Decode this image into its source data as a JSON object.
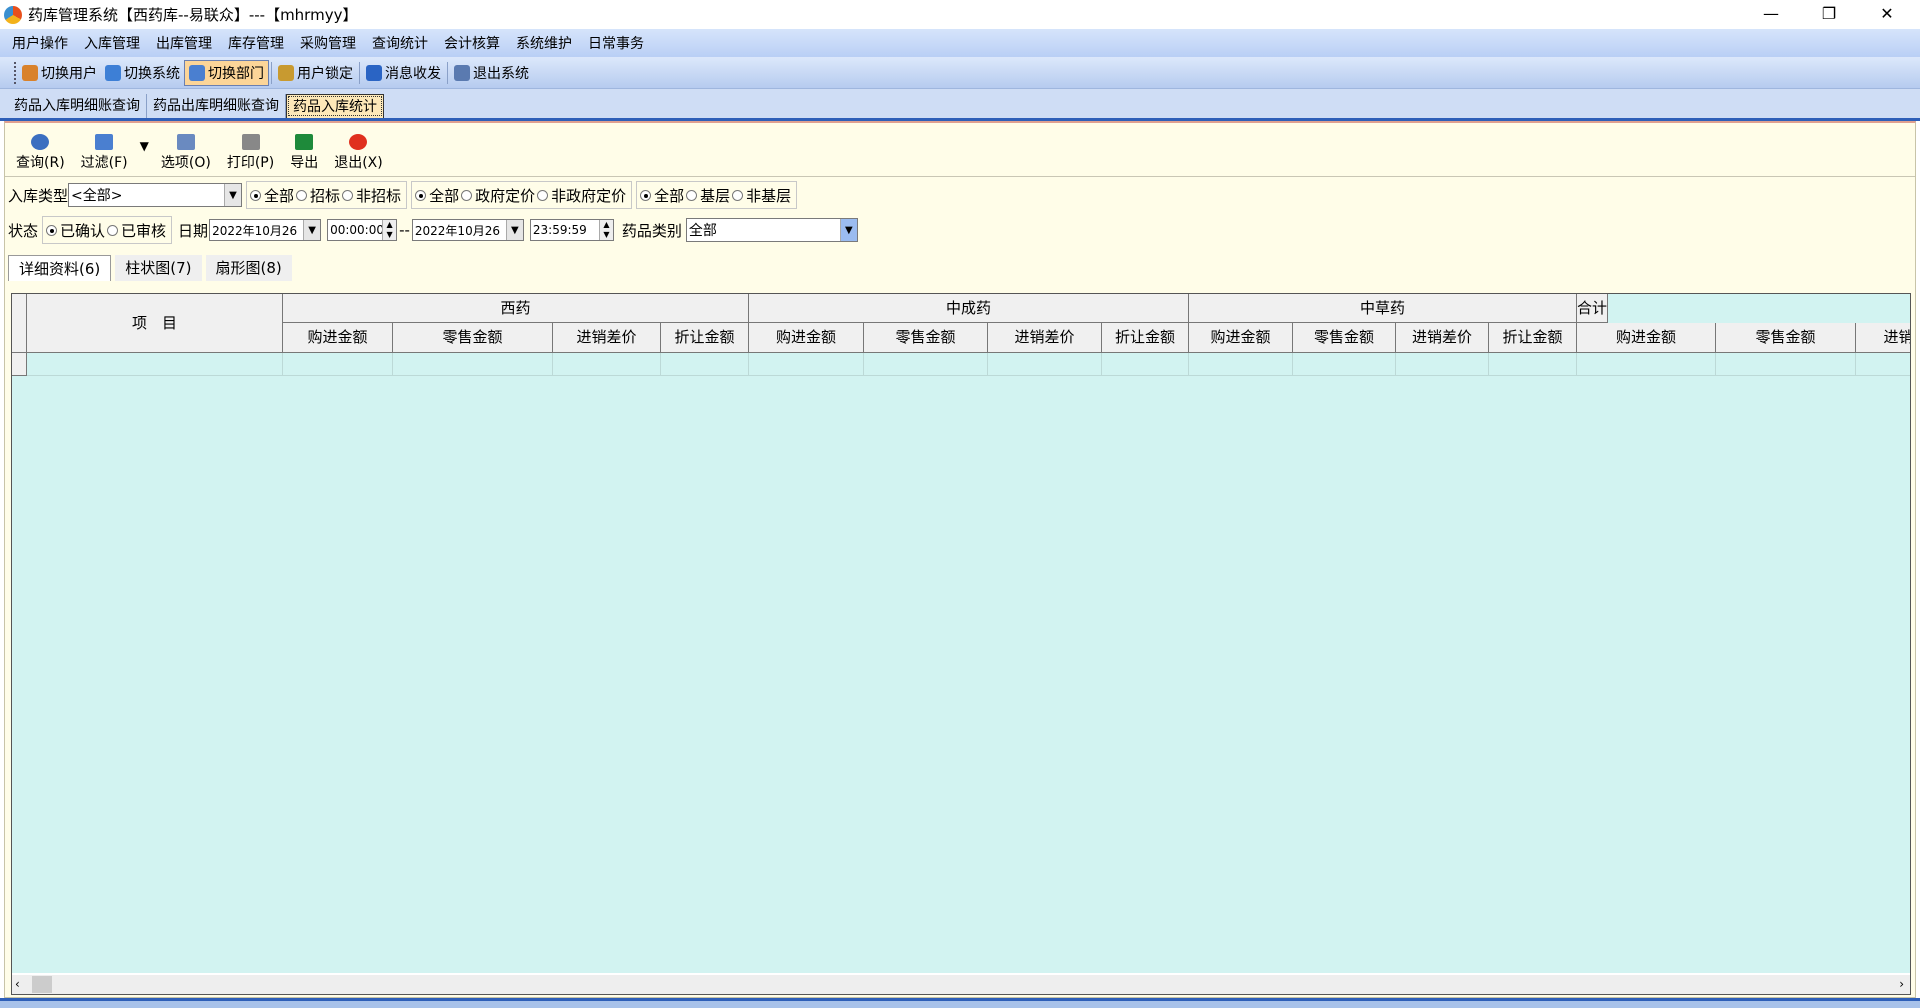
{
  "window": {
    "title": "药库管理系统【西药库--易联众】---【mhrmyy】",
    "minimize": "—",
    "restore": "❐",
    "close": "✕"
  },
  "menu": [
    "用户操作",
    "入库管理",
    "出库管理",
    "库存管理",
    "采购管理",
    "查询统计",
    "会计核算",
    "系统维护",
    "日常事务"
  ],
  "toolbar": [
    {
      "label": "切换用户",
      "icon": "users-icon",
      "color": "#d9822b"
    },
    {
      "label": "切换系统",
      "icon": "switch-system-icon",
      "color": "#3d7fd6"
    },
    {
      "label": "切换部门",
      "icon": "department-icon",
      "color": "#4a7fd0",
      "active": true
    },
    {
      "label": "用户锁定",
      "icon": "user-lock-icon",
      "color": "#c89a30"
    },
    {
      "label": "消息收发",
      "icon": "info-icon",
      "color": "#2a64c4"
    },
    {
      "label": "退出系统",
      "icon": "exit-door-icon",
      "color": "#5a7ab0"
    }
  ],
  "doc_tabs": [
    "药品入库明细账查询",
    "药品出库明细账查询",
    "药品入库统计"
  ],
  "actions": [
    {
      "label": "查询(R)",
      "icon": "refresh-icon",
      "color": "#3b6fc0"
    },
    {
      "label": "过滤(F)",
      "icon": "filter-icon",
      "color": "#4a7fd0"
    },
    {
      "label": "▼",
      "icon": "dropdown-icon"
    },
    {
      "label": "选项(O)",
      "icon": "options-icon",
      "color": "#6a8ac0"
    },
    {
      "label": "打印(P)",
      "icon": "printer-icon",
      "color": "#888"
    },
    {
      "label": "导出",
      "icon": "excel-icon",
      "color": "#1e8a3a"
    },
    {
      "label": "退出(X)",
      "icon": "power-icon",
      "color": "#e0301e"
    }
  ],
  "filters": {
    "in_type_label": "入库类型",
    "in_type_value": "<全部>",
    "bid": [
      "全部",
      "招标",
      "非招标"
    ],
    "pricing": [
      "全部",
      "政府定价",
      "非政府定价"
    ],
    "level": [
      "全部",
      "基层",
      "非基层"
    ],
    "status_label": "状态",
    "status": [
      "已确认",
      "已审核"
    ],
    "date_label": "日期",
    "date_from": "2022年10月26",
    "time_from": "00:00:00",
    "dash": "--",
    "date_to": "2022年10月26",
    "time_to": "23:59:59",
    "category_label": "药品类别",
    "category_value": "全部"
  },
  "panel_tabs": [
    "详细资料(6)",
    "柱状图(7)",
    "扇形图(8)"
  ],
  "grid": {
    "item_header": "项　目",
    "groups": [
      "西药",
      "中成药",
      "中草药",
      "合计"
    ],
    "sub": [
      "购进金额",
      "零售金额",
      "进销差价",
      "折让金额"
    ]
  },
  "colors": {
    "grid_bg": "#d2f3f1",
    "panel_bg": "#fffde8"
  }
}
